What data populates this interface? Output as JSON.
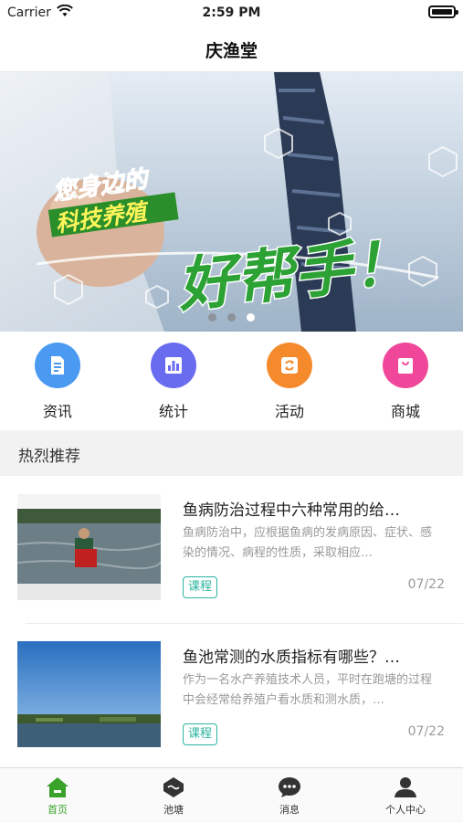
{
  "status_bar": {
    "carrier": "Carrier",
    "time": "2:59 PM"
  },
  "nav": {
    "title": "庆渔堂"
  },
  "banner": {
    "line1": "您身边的",
    "line2": "科技养殖",
    "slogan": "好帮手！",
    "page_indicator": {
      "pages": 3,
      "active_page": 3
    }
  },
  "quick_menu": [
    {
      "label": "资讯",
      "icon": "document-icon",
      "color": "#4a9af2"
    },
    {
      "label": "统计",
      "icon": "bar-chart-icon",
      "color": "#6a6cf0"
    },
    {
      "label": "活动",
      "icon": "refresh-icon",
      "color": "#f58a2c"
    },
    {
      "label": "商城",
      "icon": "shopping-bag-icon",
      "color": "#f0479a"
    }
  ],
  "section": {
    "title": "热烈推荐"
  },
  "articles": [
    {
      "title": "鱼病防治过程中六种常用的给…",
      "summary": "鱼病防治中，应根据鱼病的发病原因、症状、感染的情况、病程的性质，采取相应…",
      "tag": "课程",
      "date": "07/22"
    },
    {
      "title": "鱼池常测的水质指标有哪些？…",
      "summary": "作为一名水产养殖技术人员，平时在跑塘的过程中会经常给养殖户看水质和测水质，…",
      "tag": "课程",
      "date": "07/22"
    }
  ],
  "tab_bar": [
    {
      "label": "首页",
      "icon": "home-icon",
      "active": true
    },
    {
      "label": "池塘",
      "icon": "pond-icon",
      "active": false
    },
    {
      "label": "消息",
      "icon": "message-icon",
      "active": false
    },
    {
      "label": "个人中心",
      "icon": "person-icon",
      "active": false
    }
  ],
  "colors": {
    "accent_green": "#3aa12b",
    "tag_teal": "#2bb5a0"
  }
}
